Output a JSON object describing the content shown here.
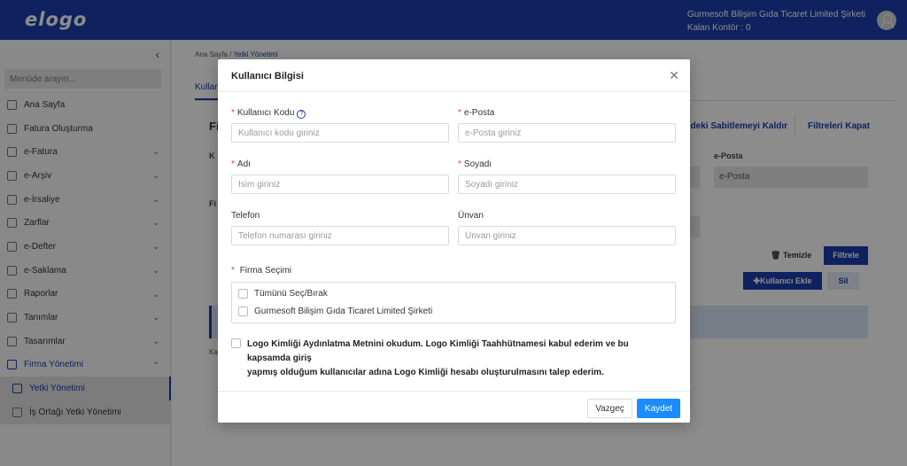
{
  "header": {
    "logo": "elogo",
    "company_name": "Gurmesoft Bilişim Gıda Ticaret Limited Şirketi",
    "credit": "Kalan Kontör : 0"
  },
  "sidebar": {
    "search_placeholder": "Menüde arayın...",
    "items": [
      {
        "label": "Ana Sayfa",
        "icon": "home-icon"
      },
      {
        "label": "Fatura Oluşturma",
        "icon": "invoice-create-icon"
      },
      {
        "label": "e-Fatura",
        "icon": "document-icon"
      },
      {
        "label": "e-Arşiv",
        "icon": "archive-icon"
      },
      {
        "label": "e-İrsaliye",
        "icon": "truck-icon"
      },
      {
        "label": "Zarflar",
        "icon": "envelope-icon"
      },
      {
        "label": "e-Defter",
        "icon": "book-icon"
      },
      {
        "label": "e-Saklama",
        "icon": "storage-icon"
      },
      {
        "label": "Raporlar",
        "icon": "chart-icon"
      },
      {
        "label": "Tanımlar",
        "icon": "list-icon"
      },
      {
        "label": "Tasarımlar",
        "icon": "image-icon"
      },
      {
        "label": "Firma Yönetimi",
        "icon": "building-icon"
      },
      {
        "label": "Yetki Yönetimi",
        "icon": "users-icon"
      },
      {
        "label": "İş Ortağı Yetki Yönetimi",
        "icon": "partner-icon"
      }
    ]
  },
  "main": {
    "breadcrumb_home": "Ana Sayfa /",
    "breadcrumb_current": "Yetki Yönetimi",
    "tab": "Kullan",
    "section_title": "Fi",
    "unpin_filters": "edeki Sabitlemeyi Kaldır",
    "close_filters": "Filtreleri Kapat",
    "label_k1": "K",
    "label_k2": "Fi",
    "eposta_label": "e-Posta",
    "eposta_placeholder": "e-Posta",
    "clear": "Temizle",
    "filter": "Filtrele",
    "add_user": "Kullanıcı Ekle",
    "delete": "Sil",
    "small_text": "Ka"
  },
  "modal": {
    "title": "Kullanıcı Bilgisi",
    "fields": {
      "user_code": {
        "label": "Kullanıcı Kodu",
        "placeholder": "Kullanıcı kodu giriniz"
      },
      "email": {
        "label": "e-Posta",
        "placeholder": "e-Posta giriniz"
      },
      "name": {
        "label": "Adı",
        "placeholder": "İsim giriniz"
      },
      "surname": {
        "label": "Soyadı",
        "placeholder": "Soyadı giriniz"
      },
      "phone": {
        "label": "Telefon",
        "placeholder": "Telefon numarası giriniz"
      },
      "title": {
        "label": "Ünvan",
        "placeholder": "Ünvan giriniz"
      }
    },
    "company_selection": {
      "label": "Firma Seçimi",
      "select_all": "Tümünü Seç/Bırak",
      "company": "Gurmesoft Bilişim Gıda Ticaret Limited Şirketi"
    },
    "consent_line1": "Logo Kimliği Aydınlatma Metnini okudum. Logo Kimliği Taahhütnamesi kabul ederim ve bu kapsamda giriş",
    "consent_line2": "yapmış olduğum kullanıcılar adına Logo Kimliği hesabı oluşturulmasını talep ederim.",
    "cancel": "Vazgeç",
    "save": "Kaydet"
  },
  "colors": {
    "brand": "#1c3fae",
    "primary_button": "#1a8cff",
    "required": "#e0383e"
  }
}
